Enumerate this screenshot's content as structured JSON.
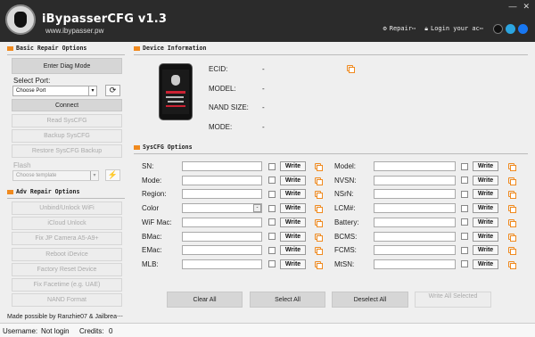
{
  "app": {
    "title": "iBypasserCFG v1.3",
    "subtitle": "www.ibypasser.pw"
  },
  "header": {
    "repair": "Repair⋯",
    "login": "Login your ac⋯"
  },
  "window": {
    "min": "—",
    "close": "✕"
  },
  "basic": {
    "title": "Basic Repair Options",
    "enter_diag": "Enter Diag Mode",
    "select_port_label": "Select Port:",
    "port_value": "Choose Port",
    "refresh_icon": "⟳",
    "connect": "Connect",
    "read": "Read SysCFG",
    "backup": "Backup SysCFG",
    "restore": "Restore SysCFG Backup",
    "flash_label": "Flash",
    "template_value": "Choose template",
    "flash_icon": "⚡"
  },
  "adv": {
    "title": "Adv Repair Options",
    "items": [
      "Unbind/Unlock WiFi",
      "iCloud Unlock",
      "Fix JP Camera A5-A9+",
      "Reboot iDevice",
      "Factory Reset Device",
      "Fix Facetime (e.g. UAE)",
      "NAND Format"
    ]
  },
  "credit": "Made possible by Ranzhie07 & Jailbrea⋯",
  "device": {
    "title": "Device Information",
    "rows": [
      {
        "label": "ECID:",
        "value": "-"
      },
      {
        "label": "MODEL:",
        "value": "-"
      },
      {
        "label": "NAND SIZE:",
        "value": "-"
      },
      {
        "label": "MODE:",
        "value": "-"
      }
    ]
  },
  "syscfg": {
    "title": "SysCFG Options",
    "write_label": "Write",
    "dropdown_icon": "-",
    "left": [
      "SN:",
      "Mode:",
      "Region:",
      "Color",
      "WiF Mac:",
      "BMac:",
      "EMac:",
      "MLB:"
    ],
    "right": [
      "Model:",
      "NVSN:",
      "NSrN:",
      "LCM#:",
      "Battery:",
      "BCMS:",
      "FCMS:",
      "MtSN:"
    ]
  },
  "actions": {
    "clear": "Clear All",
    "select": "Select All",
    "deselect": "Deselect All",
    "write_all": "Write All Selected"
  },
  "status": {
    "username_label": "Username:",
    "username_value": "Not login",
    "credits_label": "Credits:",
    "credits_value": "0"
  },
  "colors": {
    "accent": "#f08a1e",
    "header_bg": "#2b2b2b"
  }
}
